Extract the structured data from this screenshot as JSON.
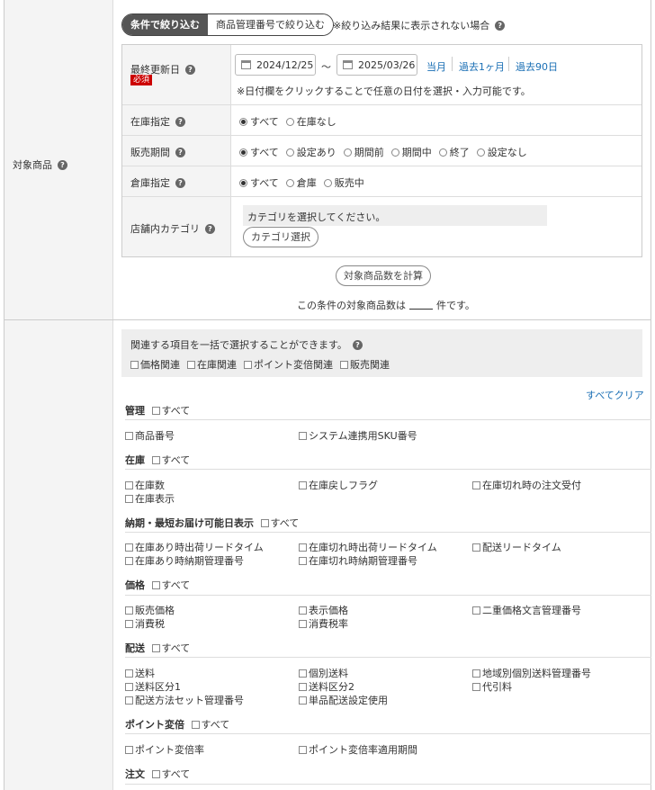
{
  "target_label": "対象商品",
  "mode_tabs": [
    "条件で絞り込む",
    "商品管理番号で絞り込む"
  ],
  "not_shown_note": "※絞り込み結果に表示されない場合",
  "last_updated": {
    "label": "最終更新日",
    "required": "必須",
    "date_from": "2024/12/25",
    "tilde": "〜",
    "date_to": "2025/03/26",
    "quick_links": [
      "当月",
      "過去1ヶ月",
      "過去90日"
    ],
    "note": "※日付欄をクリックすることで任意の日付を選択・入力可能です。"
  },
  "stock_spec": {
    "label": "在庫指定",
    "options": [
      "すべて",
      "在庫なし"
    ],
    "selected": 0
  },
  "sales_period": {
    "label": "販売期間",
    "options": [
      "すべて",
      "設定あり",
      "期間前",
      "期間中",
      "終了",
      "設定なし"
    ],
    "selected": 0
  },
  "warehouse_spec": {
    "label": "倉庫指定",
    "options": [
      "すべて",
      "倉庫",
      "販売中"
    ],
    "selected": 0
  },
  "category": {
    "label": "店舗内カテゴリ",
    "placeholder": "カテゴリを選択してください。",
    "button": "カテゴリ選択"
  },
  "calc_button": "対象商品数を計算",
  "count_text_pre": "この条件の対象商品数は",
  "count_text_post": "件です。",
  "bulk": {
    "title": "関連する項目を一括で選択することができます。",
    "options": [
      "価格関連",
      "在庫関連",
      "ポイント変倍関連",
      "販売関連"
    ]
  },
  "clear_all": "すべてクリア",
  "all_label": "すべて",
  "groups": {
    "kanri": {
      "title": "管理",
      "items": [
        "商品番号",
        "システム連携用SKU番号"
      ]
    },
    "zaiko": {
      "title": "在庫",
      "items": [
        "在庫数",
        "在庫戻しフラグ",
        "在庫切れ時の注文受付",
        "在庫表示"
      ]
    },
    "nouki": {
      "title": "納期・最短お届け可能日表示",
      "items": [
        "在庫あり時出荷リードタイム",
        "在庫切れ時出荷リードタイム",
        "配送リードタイム",
        "在庫あり時納期管理番号",
        "在庫切れ時納期管理番号"
      ]
    },
    "kakaku": {
      "title": "価格",
      "items": [
        "販売価格",
        "表示価格",
        "二重価格文言管理番号",
        "消費税",
        "消費税率"
      ]
    },
    "haisou": {
      "title": "配送",
      "items": [
        "送料",
        "個別送料",
        "地域別個別送料管理番号",
        "送料区分1",
        "送料区分2",
        "代引料",
        "配送方法セット管理番号",
        "単品配送設定使用"
      ]
    },
    "point": {
      "title": "ポイント変倍",
      "items": [
        "ポイント変倍率",
        "ポイント変倍率適用期間"
      ]
    },
    "chumon": {
      "title": "注文"
    }
  }
}
